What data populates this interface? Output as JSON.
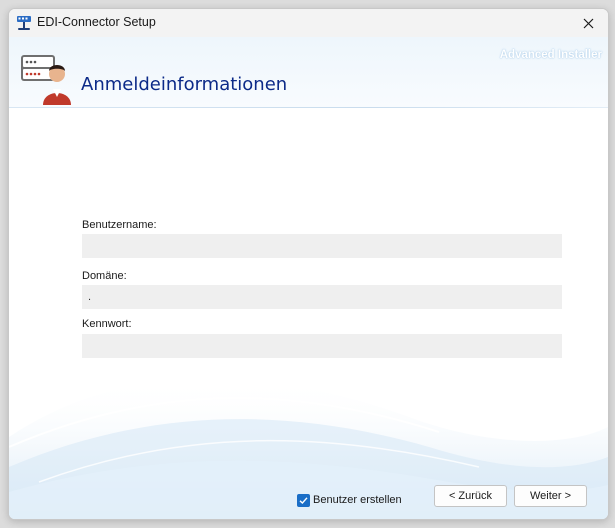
{
  "window": {
    "title": "EDI-Connector Setup",
    "app_icon": "installer-app-icon",
    "close_icon": "close-icon"
  },
  "header": {
    "title": "Anmeldeinformationen",
    "brand": "Advanced Installer",
    "icon": "user-credentials-icon"
  },
  "form": {
    "username": {
      "label": "Benutzername:",
      "value": ""
    },
    "domain": {
      "label": "Domäne:",
      "value": "."
    },
    "password": {
      "label": "Kennwort:",
      "value": ""
    }
  },
  "footer": {
    "create_user": {
      "label": "Benutzer erstellen",
      "checked": true
    },
    "back_label": "< Zurück",
    "next_label": "Weiter >"
  },
  "colors": {
    "title_blue": "#0c2a88",
    "checkbox_accent": "#1a6ec7",
    "input_bg": "#efefef",
    "header_bg": "#eef6fc"
  }
}
